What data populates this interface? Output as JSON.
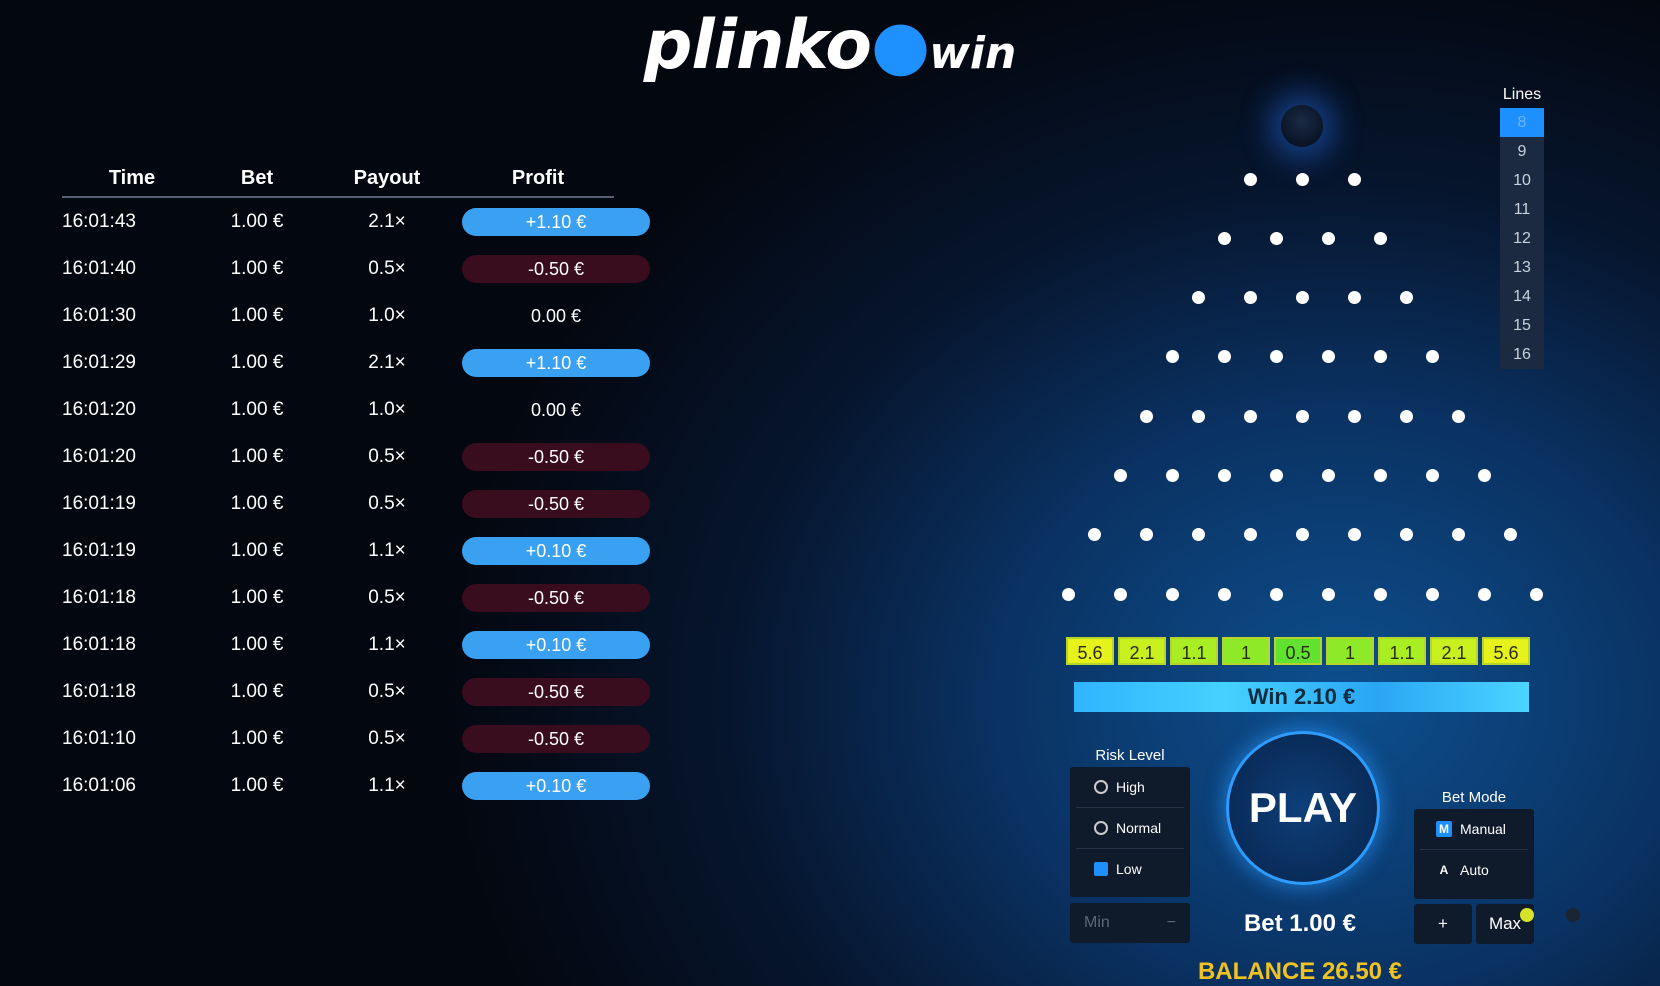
{
  "logo": {
    "main": "plinko",
    "suffix": "win"
  },
  "history": {
    "headers": {
      "time": "Time",
      "bet": "Bet",
      "payout": "Payout",
      "profit": "Profit"
    },
    "rows": [
      {
        "time": "16:01:43",
        "bet": "1.00 €",
        "payout": "2.1×",
        "profit": "+1.10 €",
        "kind": "pos"
      },
      {
        "time": "16:01:40",
        "bet": "1.00 €",
        "payout": "0.5×",
        "profit": "-0.50 €",
        "kind": "neg"
      },
      {
        "time": "16:01:30",
        "bet": "1.00 €",
        "payout": "1.0×",
        "profit": "0.00 €",
        "kind": "zero"
      },
      {
        "time": "16:01:29",
        "bet": "1.00 €",
        "payout": "2.1×",
        "profit": "+1.10 €",
        "kind": "pos"
      },
      {
        "time": "16:01:20",
        "bet": "1.00 €",
        "payout": "1.0×",
        "profit": "0.00 €",
        "kind": "zero"
      },
      {
        "time": "16:01:20",
        "bet": "1.00 €",
        "payout": "0.5×",
        "profit": "-0.50 €",
        "kind": "neg"
      },
      {
        "time": "16:01:19",
        "bet": "1.00 €",
        "payout": "0.5×",
        "profit": "-0.50 €",
        "kind": "neg"
      },
      {
        "time": "16:01:19",
        "bet": "1.00 €",
        "payout": "1.1×",
        "profit": "+0.10 €",
        "kind": "pos"
      },
      {
        "time": "16:01:18",
        "bet": "1.00 €",
        "payout": "0.5×",
        "profit": "-0.50 €",
        "kind": "neg"
      },
      {
        "time": "16:01:18",
        "bet": "1.00 €",
        "payout": "1.1×",
        "profit": "+0.10 €",
        "kind": "pos"
      },
      {
        "time": "16:01:18",
        "bet": "1.00 €",
        "payout": "0.5×",
        "profit": "-0.50 €",
        "kind": "neg"
      },
      {
        "time": "16:01:10",
        "bet": "1.00 €",
        "payout": "0.5×",
        "profit": "-0.50 €",
        "kind": "neg"
      },
      {
        "time": "16:01:06",
        "bet": "1.00 €",
        "payout": "1.1×",
        "profit": "+0.10 €",
        "kind": "pos"
      }
    ]
  },
  "lines": {
    "title": "Lines",
    "options": [
      "8",
      "9",
      "10",
      "11",
      "12",
      "13",
      "14",
      "15",
      "16"
    ],
    "selected": "8"
  },
  "board": {
    "rows": 8
  },
  "multipliers": [
    {
      "value": "5.6",
      "color": "#e6f21a"
    },
    {
      "value": "2.1",
      "color": "#c8f01e"
    },
    {
      "value": "1.1",
      "color": "#a8ee22"
    },
    {
      "value": "1",
      "color": "#8eea28"
    },
    {
      "value": "0.5",
      "color": "#62e230"
    },
    {
      "value": "1",
      "color": "#8eea28"
    },
    {
      "value": "1.1",
      "color": "#a8ee22"
    },
    {
      "value": "2.1",
      "color": "#c8f01e"
    },
    {
      "value": "5.6",
      "color": "#e6f21a"
    }
  ],
  "win": "Win 2.10 €",
  "risk": {
    "label": "Risk Level",
    "items": [
      {
        "label": "High",
        "icon": "flame-icon",
        "selected": false
      },
      {
        "label": "Normal",
        "icon": "cup-icon",
        "selected": false
      },
      {
        "label": "Low",
        "icon": "lock-icon",
        "selected": true
      }
    ]
  },
  "bet_controls": {
    "min": "Min",
    "minus": "−",
    "plus": "+",
    "max": "Max"
  },
  "play": "PLAY",
  "bet": "Bet 1.00 €",
  "balance": "BALANCE 26.50 €",
  "bet_mode": {
    "label": "Bet Mode",
    "items": [
      {
        "label": "Manual",
        "key": "M",
        "selected": true
      },
      {
        "label": "Auto",
        "key": "A",
        "selected": false
      }
    ]
  }
}
